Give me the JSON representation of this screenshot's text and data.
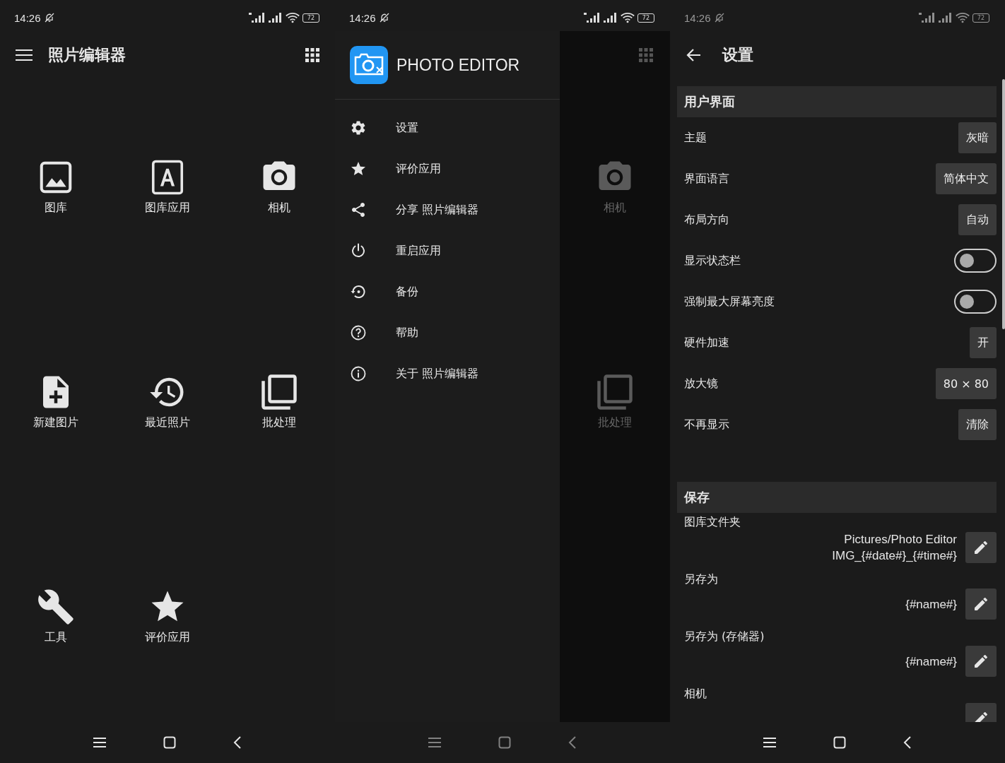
{
  "home": {
    "status_bar": {
      "time": "14:26",
      "battery": "72"
    },
    "title": "照片编辑器",
    "tiles": [
      {
        "kind": "gallery",
        "label": "图库"
      },
      {
        "kind": "gallery_app",
        "label": "图库应用"
      },
      {
        "kind": "camera",
        "label": "相机"
      },
      {
        "kind": "new_image",
        "label": "新建图片"
      },
      {
        "kind": "recent",
        "label": "最近照片"
      },
      {
        "kind": "batch",
        "label": "批处理"
      },
      {
        "kind": "tools",
        "label": "工具"
      },
      {
        "kind": "rate",
        "label": "评价应用"
      }
    ]
  },
  "drawer": {
    "status_bar": {
      "time": "14:26",
      "battery": "72"
    },
    "app_name": "PHOTO EDITOR",
    "items": [
      {
        "kind": "settings",
        "label": "设置"
      },
      {
        "kind": "rate",
        "label": "评价应用"
      },
      {
        "kind": "share",
        "label": "分享 照片编辑器"
      },
      {
        "kind": "restart",
        "label": "重启应用"
      },
      {
        "kind": "backup",
        "label": "备份"
      },
      {
        "kind": "help",
        "label": "帮助"
      },
      {
        "kind": "about",
        "label": "关于 照片编辑器"
      }
    ],
    "behind_tiles": [
      {
        "kind": "camera",
        "label": "相机"
      },
      {
        "kind": "batch",
        "label": "批处理"
      }
    ]
  },
  "settings": {
    "status_bar": {
      "time": "14:26",
      "battery": "72"
    },
    "title": "设置",
    "sections": [
      {
        "title": "用户界面",
        "rows": [
          {
            "kind": "button",
            "label": "主题",
            "value": "灰暗"
          },
          {
            "kind": "button",
            "label": "界面语言",
            "value": "简体中文"
          },
          {
            "kind": "button",
            "label": "布局方向",
            "value": "自动"
          },
          {
            "kind": "toggle",
            "label": "显示状态栏",
            "on": false
          },
          {
            "kind": "toggle",
            "label": "强制最大屏幕亮度",
            "on": false
          },
          {
            "kind": "button",
            "label": "硬件加速",
            "value": "开"
          },
          {
            "kind": "button",
            "label": "放大镜",
            "value": "80 × 80"
          },
          {
            "kind": "button",
            "label": "不再显示",
            "value": "清除"
          }
        ]
      },
      {
        "title": "保存",
        "rows": [
          {
            "kind": "edit",
            "label": "图库文件夹",
            "values": [
              "Pictures/Photo Editor",
              "IMG_{#date#}_{#time#}"
            ]
          },
          {
            "kind": "edit",
            "label": "另存为",
            "values": [
              "{#name#}"
            ]
          },
          {
            "kind": "edit",
            "label": "另存为 (存储器)",
            "values": [
              "{#name#}"
            ]
          },
          {
            "kind": "edit",
            "label": "相机"
          }
        ]
      }
    ]
  }
}
